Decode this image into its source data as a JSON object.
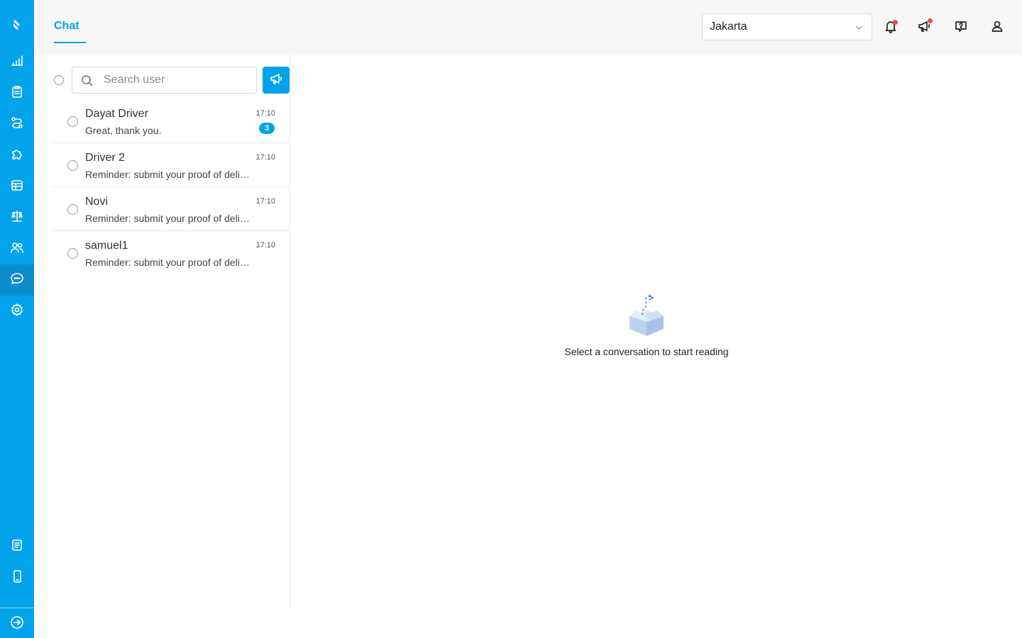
{
  "sidebar": {
    "items": [
      {
        "icon": "logo-icon"
      },
      {
        "icon": "chart-icon"
      },
      {
        "icon": "clipboard-icon"
      },
      {
        "icon": "route-icon"
      },
      {
        "icon": "puzzle-icon"
      },
      {
        "icon": "database-icon"
      },
      {
        "icon": "scale-icon"
      },
      {
        "icon": "users-icon"
      },
      {
        "icon": "chat-icon",
        "active": true
      },
      {
        "icon": "gear-icon"
      },
      {
        "icon": "document-icon"
      },
      {
        "icon": "phone-icon"
      },
      {
        "icon": "logout-icon"
      }
    ]
  },
  "header": {
    "tab_label": "Chat",
    "city_select": "Jakarta",
    "icons": [
      "bell-icon",
      "megaphone-icon",
      "help-icon",
      "user-icon"
    ]
  },
  "chat_list": {
    "search_placeholder": "Search user",
    "conversations": [
      {
        "name": "Dayat Driver",
        "message": "Great, thank you.",
        "time": "17:10",
        "unread": "3"
      },
      {
        "name": "Driver 2",
        "message": "Reminder: submit your proof of delivery photos",
        "time": "17:10"
      },
      {
        "name": "Novi",
        "message": "Reminder: submit your proof of delivery photos",
        "time": "17:10"
      },
      {
        "name": "samuel1",
        "message": "Reminder: submit your proof of delivery photos",
        "time": "17:10"
      }
    ]
  },
  "empty_state": {
    "text": "Select a conversation to start reading"
  },
  "colors": {
    "accent": "#03a3ec",
    "notification_dot": "#ef4a4a"
  }
}
